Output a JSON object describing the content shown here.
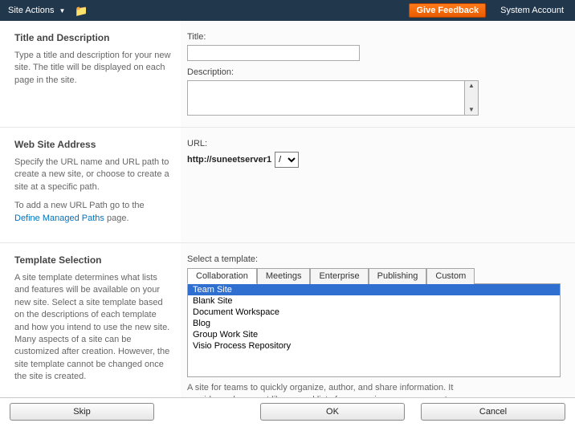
{
  "ribbon": {
    "site_actions": "Site Actions",
    "give_feedback": "Give Feedback",
    "system_account": "System Account"
  },
  "sections": {
    "title_desc": {
      "heading": "Title and Description",
      "help": "Type a title and description for your new site. The title will be displayed on each page in the site.",
      "title_label": "Title:",
      "title_value": "",
      "desc_label": "Description:",
      "desc_value": ""
    },
    "address": {
      "heading": "Web Site Address",
      "help1": "Specify the URL name and URL path to create a new site, or choose to create a site at a specific path.",
      "help2_pre": "To add a new URL Path go to the ",
      "help2_link": "Define Managed Paths",
      "help2_post": " page.",
      "url_label": "URL:",
      "url_base": "http://suneetserver1",
      "url_path_options": [
        "/"
      ],
      "url_path_selected": "/",
      "url_name": ""
    },
    "template": {
      "heading": "Template Selection",
      "help": "A site template determines what lists and features will be available on your new site. Select a site template based on the descriptions of each template and how you intend to use the new site. Many aspects of a site can be customized after creation. However, the site template cannot be changed once the site is created.",
      "select_label": "Select a template:",
      "tabs": [
        "Collaboration",
        "Meetings",
        "Enterprise",
        "Publishing",
        "Custom"
      ],
      "active_tab": "Collaboration",
      "templates": [
        {
          "name": "Team Site",
          "selected": true
        },
        {
          "name": "Blank Site",
          "selected": false
        },
        {
          "name": "Document Workspace",
          "selected": false
        },
        {
          "name": "Blog",
          "selected": false
        },
        {
          "name": "Group Work Site",
          "selected": false
        },
        {
          "name": "Visio Process Repository",
          "selected": false
        }
      ],
      "template_help": "A site for teams to quickly organize, author, and share information. It provides a document library, and lists for managing announcements, calendar items, tasks, and discussions."
    }
  },
  "footer": {
    "skip": "Skip",
    "ok": "OK",
    "cancel": "Cancel"
  }
}
